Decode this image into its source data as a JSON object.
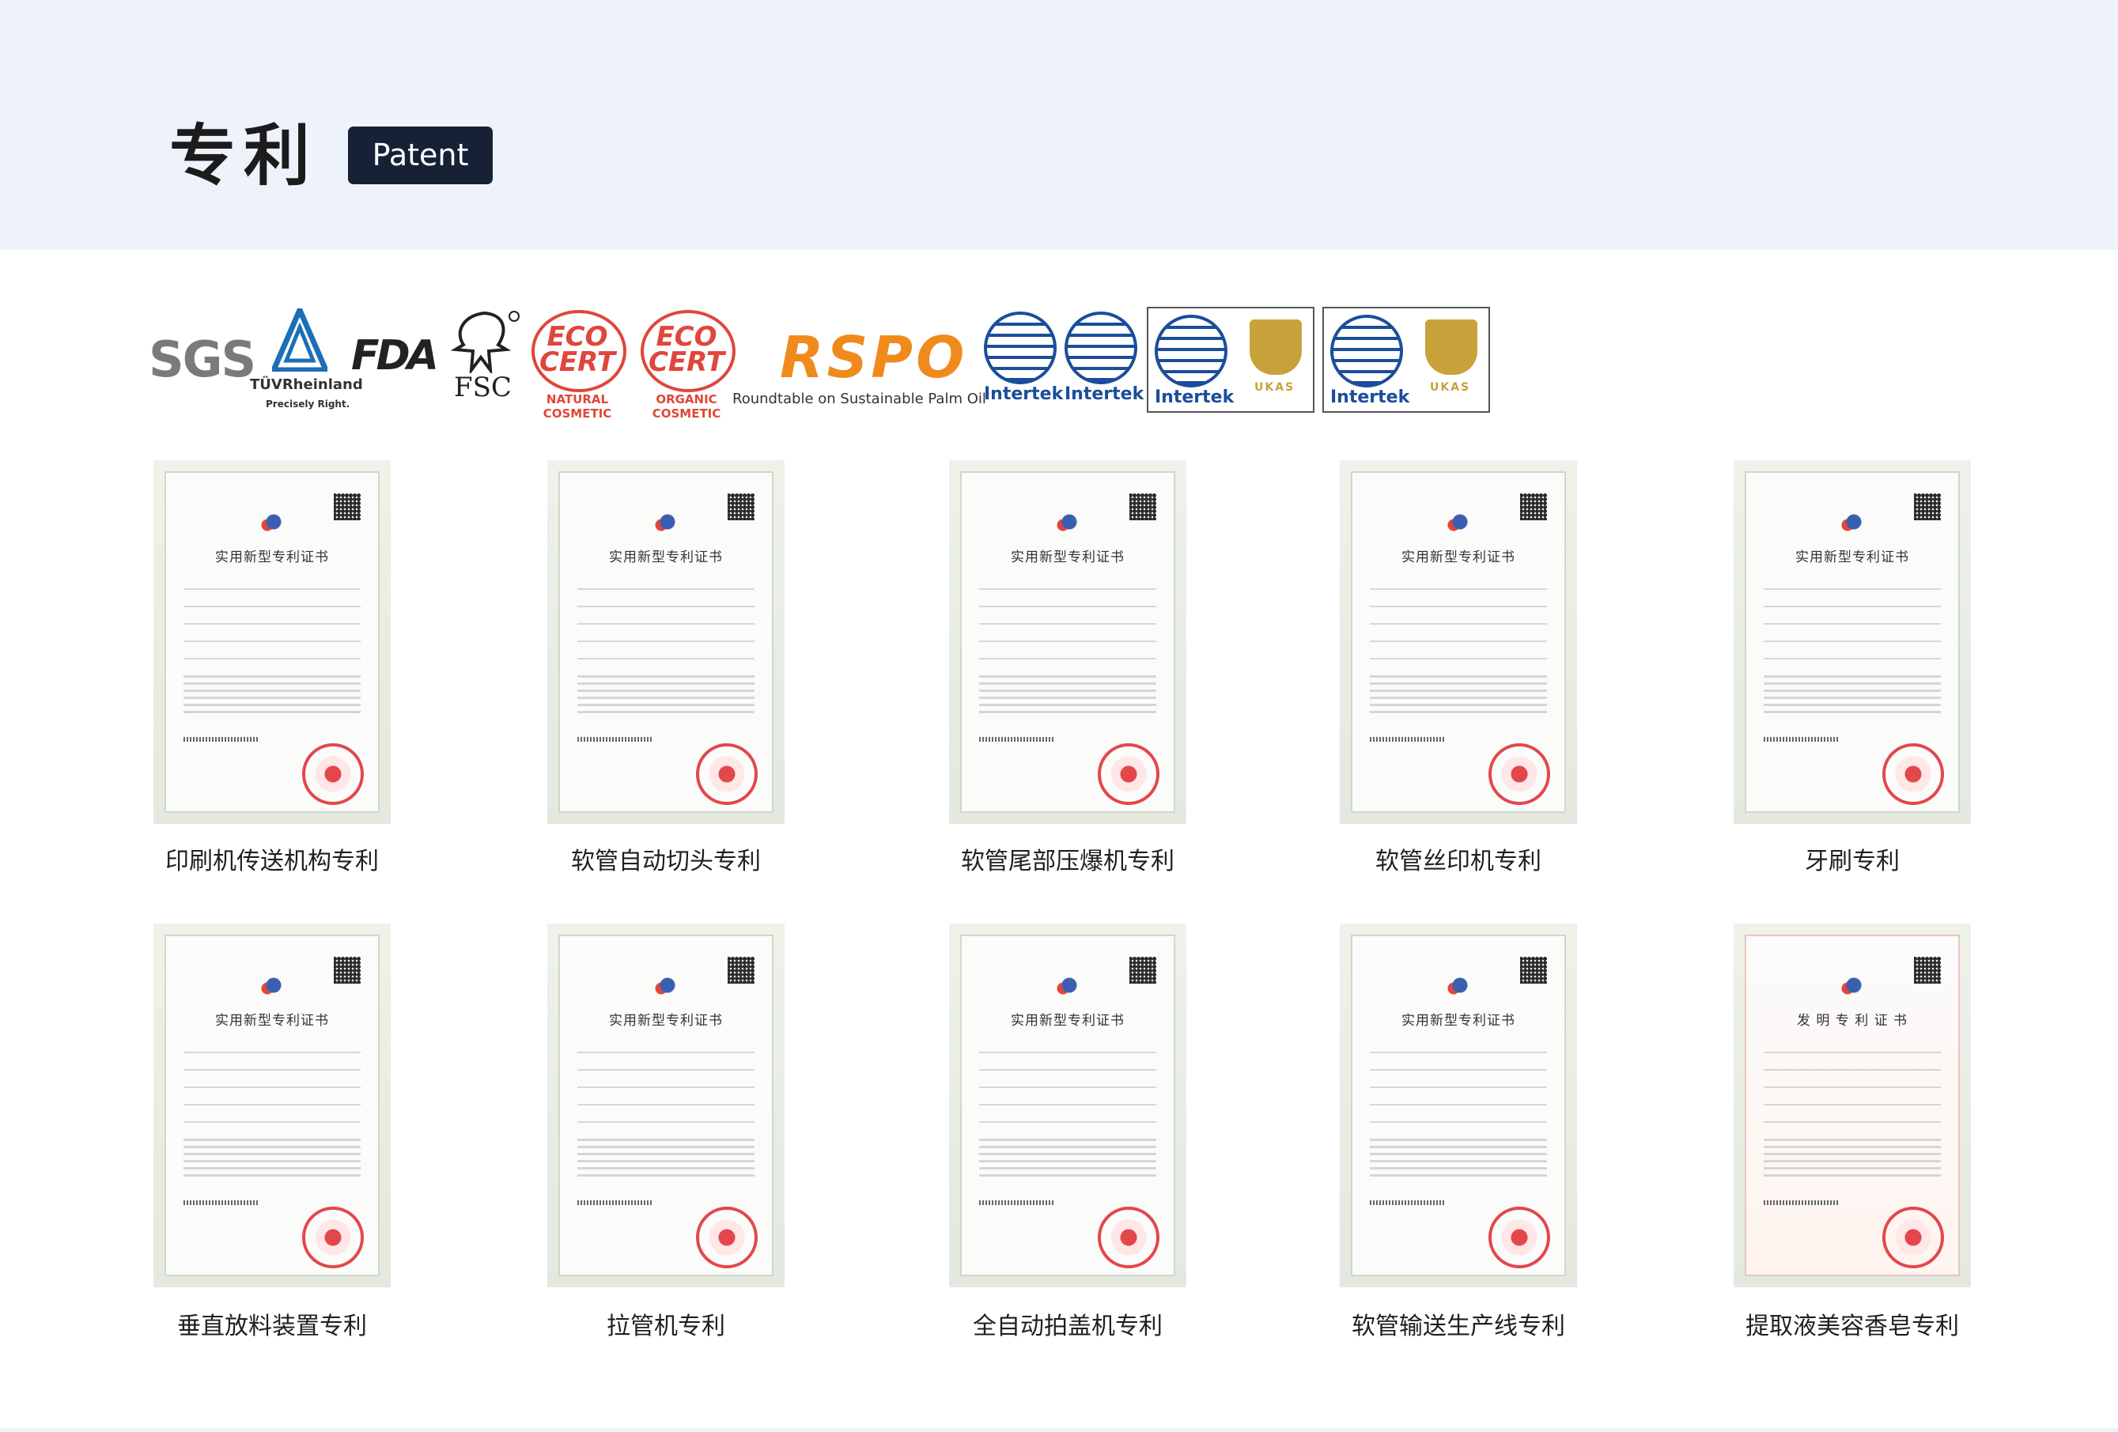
{
  "header": {
    "title": "专利",
    "badge": "Patent"
  },
  "logos": {
    "sgs": "SGS",
    "tuv_name": "TÜVRheinland",
    "tuv_sub": "Precisely Right.",
    "fda": "FDA",
    "fsc": "FSC",
    "eco_text": "ECO CERT",
    "eco1_sub": "NATURAL COSMETIC",
    "eco2_sub": "ORGANIC COSMETIC",
    "rspo": "RSPO",
    "rspo_sub": "Roundtable on Sustainable Palm Oil",
    "intertek": "Intertek",
    "ukas": "UKAS"
  },
  "certificates": [
    {
      "caption": "印刷机传送机构专利",
      "title": "实用新型专利证书"
    },
    {
      "caption": "软管自动切头专利",
      "title": "实用新型专利证书"
    },
    {
      "caption": "软管尾部压爆机专利",
      "title": "实用新型专利证书"
    },
    {
      "caption": "软管丝印机专利",
      "title": "实用新型专利证书"
    },
    {
      "caption": "牙刷专利",
      "title": "实用新型专利证书"
    },
    {
      "caption": "垂直放料装置专利",
      "title": "实用新型专利证书"
    },
    {
      "caption": "拉管机专利",
      "title": "实用新型专利证书"
    },
    {
      "caption": "全自动拍盖机专利",
      "title": "实用新型专利证书"
    },
    {
      "caption": "软管输送生产线专利",
      "title": "实用新型专利证书"
    },
    {
      "caption": "提取液美容香皂专利",
      "title": "发 明 专 利 证 书"
    }
  ],
  "colors": {
    "header_bg": "#eef3fb",
    "badge_bg": "#172136",
    "seal_red": "#e3474b",
    "intertek_blue": "#1a4e9a",
    "eco_red": "#e0463b",
    "rspo_orange": "#f08a1c"
  }
}
